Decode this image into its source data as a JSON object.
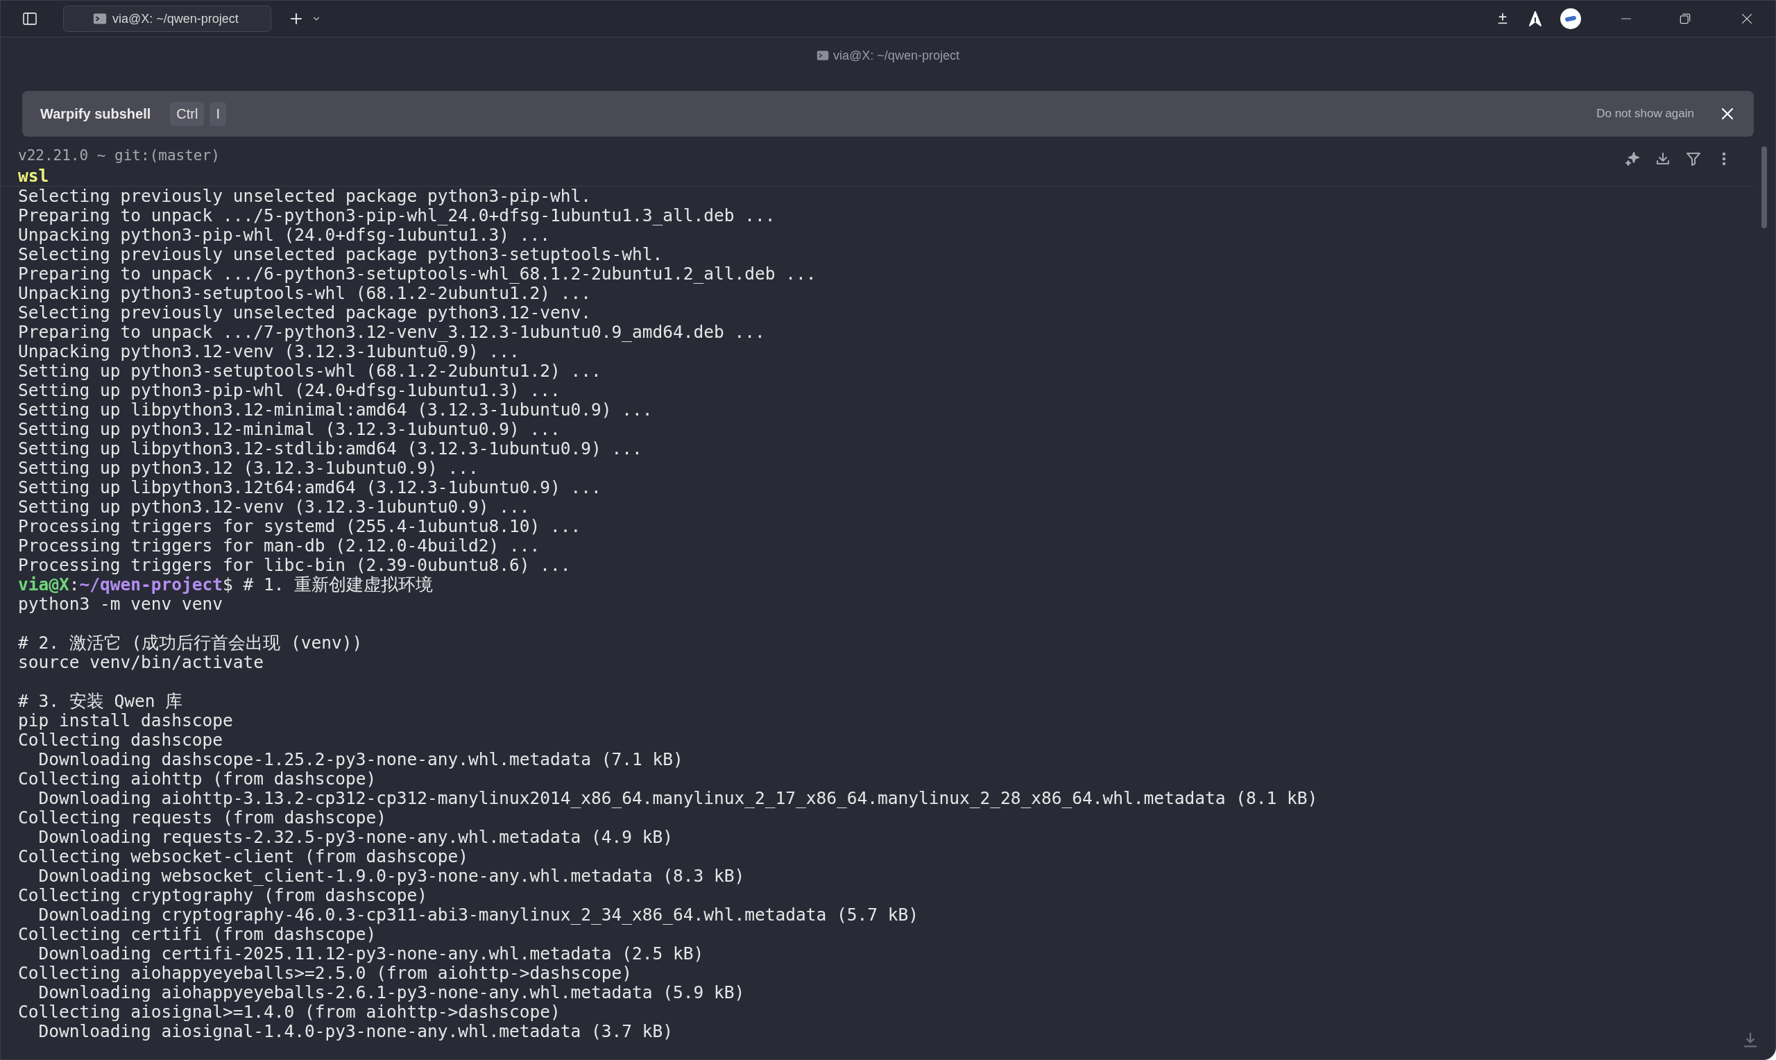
{
  "tab": {
    "title": "via@X: ~/qwen-project"
  },
  "pane_title": "via@X: ~/qwen-project",
  "banner": {
    "title": "Warpify subshell",
    "keys": [
      "Ctrl",
      "I"
    ],
    "dismiss": "Do not show again"
  },
  "block_header": {
    "context": "v22.21.0 ~ git:(master)",
    "command": "wsl"
  },
  "lines": [
    {
      "kind": "output",
      "text": "Selecting previously unselected package python3-pip-whl."
    },
    {
      "kind": "output",
      "text": "Preparing to unpack .../5-python3-pip-whl_24.0+dfsg-1ubuntu1.3_all.deb ..."
    },
    {
      "kind": "output",
      "text": "Unpacking python3-pip-whl (24.0+dfsg-1ubuntu1.3) ..."
    },
    {
      "kind": "output",
      "text": "Selecting previously unselected package python3-setuptools-whl."
    },
    {
      "kind": "output",
      "text": "Preparing to unpack .../6-python3-setuptools-whl_68.1.2-2ubuntu1.2_all.deb ..."
    },
    {
      "kind": "output",
      "text": "Unpacking python3-setuptools-whl (68.1.2-2ubuntu1.2) ..."
    },
    {
      "kind": "output",
      "text": "Selecting previously unselected package python3.12-venv."
    },
    {
      "kind": "output",
      "text": "Preparing to unpack .../7-python3.12-venv_3.12.3-1ubuntu0.9_amd64.deb ..."
    },
    {
      "kind": "output",
      "text": "Unpacking python3.12-venv (3.12.3-1ubuntu0.9) ..."
    },
    {
      "kind": "output",
      "text": "Setting up python3-setuptools-whl (68.1.2-2ubuntu1.2) ..."
    },
    {
      "kind": "output",
      "text": "Setting up python3-pip-whl (24.0+dfsg-1ubuntu1.3) ..."
    },
    {
      "kind": "output",
      "text": "Setting up libpython3.12-minimal:amd64 (3.12.3-1ubuntu0.9) ..."
    },
    {
      "kind": "output",
      "text": "Setting up python3.12-minimal (3.12.3-1ubuntu0.9) ..."
    },
    {
      "kind": "output",
      "text": "Setting up libpython3.12-stdlib:amd64 (3.12.3-1ubuntu0.9) ..."
    },
    {
      "kind": "output",
      "text": "Setting up python3.12 (3.12.3-1ubuntu0.9) ..."
    },
    {
      "kind": "output",
      "text": "Setting up libpython3.12t64:amd64 (3.12.3-1ubuntu0.9) ..."
    },
    {
      "kind": "output",
      "text": "Setting up python3.12-venv (3.12.3-1ubuntu0.9) ..."
    },
    {
      "kind": "output",
      "text": "Processing triggers for systemd (255.4-1ubuntu8.10) ..."
    },
    {
      "kind": "output",
      "text": "Processing triggers for man-db (2.12.0-4build2) ..."
    },
    {
      "kind": "output",
      "text": "Processing triggers for libc-bin (2.39-0ubuntu8.6) ..."
    },
    {
      "kind": "prompt",
      "user": "via@X",
      "separator": ":",
      "path": "~/qwen-project",
      "text": "$ # 1. 重新创建虚拟环境"
    },
    {
      "kind": "output",
      "text": "python3 -m venv venv"
    },
    {
      "kind": "blank"
    },
    {
      "kind": "output",
      "text": "# 2. 激活它 (成功后行首会出现 (venv))"
    },
    {
      "kind": "output",
      "text": "source venv/bin/activate"
    },
    {
      "kind": "blank"
    },
    {
      "kind": "output",
      "text": "# 3. 安装 Qwen 库"
    },
    {
      "kind": "output",
      "text": "pip install dashscope"
    },
    {
      "kind": "output",
      "text": "Collecting dashscope"
    },
    {
      "kind": "output",
      "text": "  Downloading dashscope-1.25.2-py3-none-any.whl.metadata (7.1 kB)"
    },
    {
      "kind": "output",
      "text": "Collecting aiohttp (from dashscope)"
    },
    {
      "kind": "output",
      "text": "  Downloading aiohttp-3.13.2-cp312-cp312-manylinux2014_x86_64.manylinux_2_17_x86_64.manylinux_2_28_x86_64.whl.metadata (8.1 kB)"
    },
    {
      "kind": "output",
      "text": "Collecting requests (from dashscope)"
    },
    {
      "kind": "output",
      "text": "  Downloading requests-2.32.5-py3-none-any.whl.metadata (4.9 kB)"
    },
    {
      "kind": "output",
      "text": "Collecting websocket-client (from dashscope)"
    },
    {
      "kind": "output",
      "text": "  Downloading websocket_client-1.9.0-py3-none-any.whl.metadata (8.3 kB)"
    },
    {
      "kind": "output",
      "text": "Collecting cryptography (from dashscope)"
    },
    {
      "kind": "output",
      "text": "  Downloading cryptography-46.0.3-cp311-abi3-manylinux_2_34_x86_64.whl.metadata (5.7 kB)"
    },
    {
      "kind": "output",
      "text": "Collecting certifi (from dashscope)"
    },
    {
      "kind": "output",
      "text": "  Downloading certifi-2025.11.12-py3-none-any.whl.metadata (2.5 kB)"
    },
    {
      "kind": "output",
      "text": "Collecting aiohappyeyeballs>=2.5.0 (from aiohttp->dashscope)"
    },
    {
      "kind": "output",
      "text": "  Downloading aiohappyeyeballs-2.6.1-py3-none-any.whl.metadata (5.9 kB)"
    },
    {
      "kind": "output",
      "text": "Collecting aiosignal>=1.4.0 (from aiohttp->dashscope)"
    },
    {
      "kind": "output",
      "text": "  Downloading aiosignal-1.4.0-py3-none-any.whl.metadata (3.7 kB)"
    }
  ]
}
